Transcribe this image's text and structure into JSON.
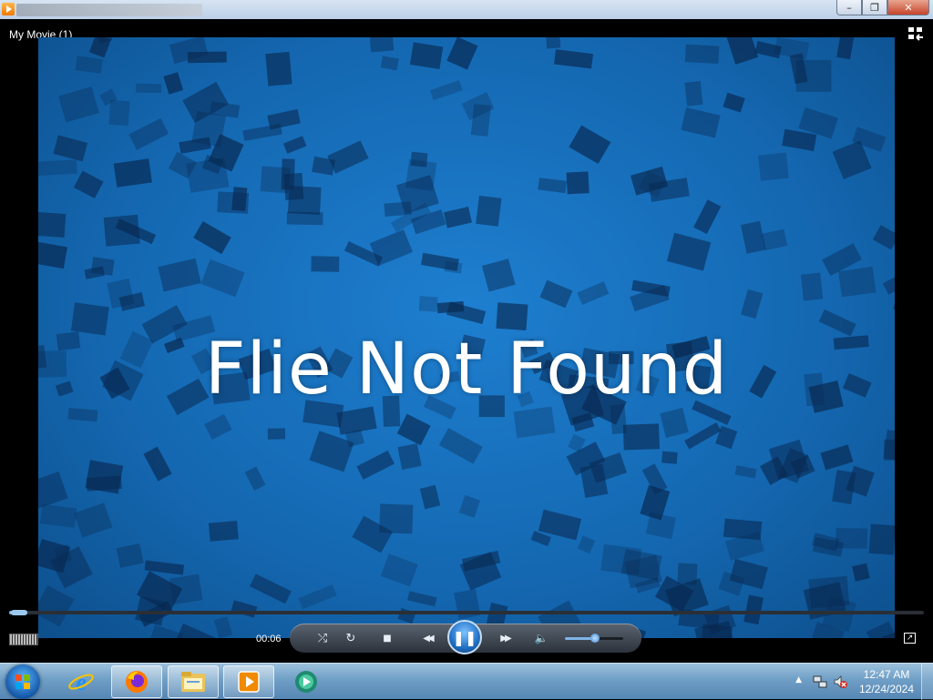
{
  "window": {
    "title": "My Movie (1)",
    "controls": {
      "minimize": "–",
      "restore": "❐",
      "close": "✕"
    }
  },
  "player": {
    "movie_title": "My Movie (1)",
    "message": "Flie Not Found",
    "elapsed_time": "00:06",
    "seek_progress": 0.02,
    "volume_level": 0.52,
    "icons": {
      "switch_view": "switch-to-library-icon",
      "shuffle": "shuffle-icon",
      "repeat": "repeat-icon",
      "stop": "stop-icon",
      "previous": "previous-icon",
      "play_pause": "pause-icon",
      "next": "next-icon",
      "mute": "volume-icon",
      "fullscreen": "fullscreen-icon"
    },
    "glyphs": {
      "shuffle": "⤮",
      "repeat": "↻",
      "stop": "■",
      "previous": "◀◀",
      "pause": "❚❚",
      "next": "▶▶",
      "volume": "🔈",
      "fullscreen": "↗"
    },
    "colors": {
      "video_bg": "#1467b0",
      "accent": "#7fb5e6"
    }
  },
  "taskbar": {
    "apps": [
      {
        "name": "internet-explorer-icon",
        "open": false
      },
      {
        "name": "firefox-icon",
        "open": true
      },
      {
        "name": "file-explorer-icon",
        "open": true
      },
      {
        "name": "media-player-icon",
        "open": true
      },
      {
        "name": "media-center-icon",
        "open": false
      }
    ],
    "tray": {
      "show_hidden": "▲",
      "time": "12:47 AM",
      "date": "12/24/2024"
    }
  }
}
